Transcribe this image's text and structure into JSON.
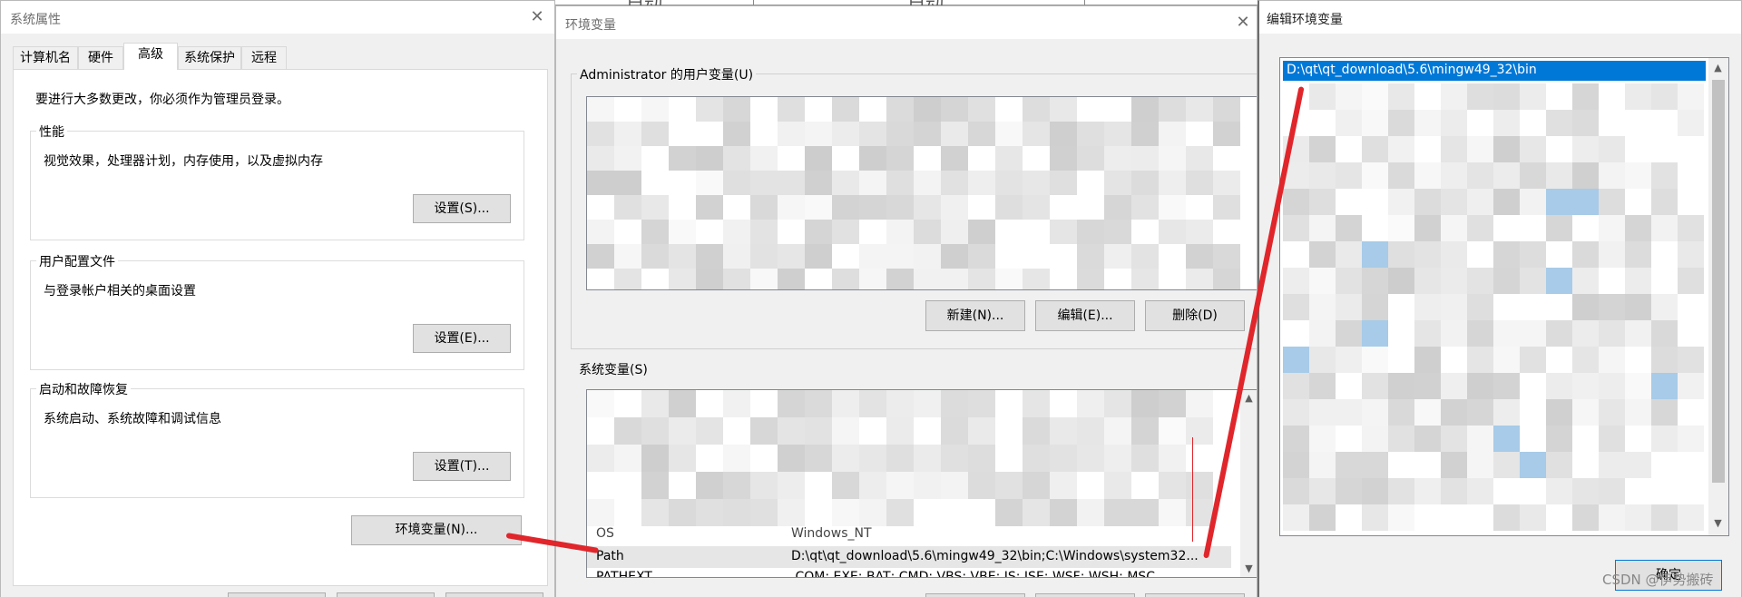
{
  "system_properties": {
    "title": "系统属性",
    "tabs": [
      {
        "label": "计算机名",
        "active": false
      },
      {
        "label": "硬件",
        "active": false
      },
      {
        "label": "高级",
        "active": true
      },
      {
        "label": "系统保护",
        "active": false
      },
      {
        "label": "远程",
        "active": false
      }
    ],
    "admin_notice": "要进行大多数更改，你必须作为管理员登录。",
    "performance": {
      "title": "性能",
      "desc": "视觉效果，处理器计划，内存使用，以及虚拟内存",
      "button": "设置(S)..."
    },
    "user_profiles": {
      "title": "用户配置文件",
      "desc": "与登录帐户相关的桌面设置",
      "button": "设置(E)..."
    },
    "startup_recovery": {
      "title": "启动和故障恢复",
      "desc": "系统启动、系统故障和调试信息",
      "button": "设置(T)..."
    },
    "env_button": "环境变量(N)..."
  },
  "env_vars": {
    "title": "环境变量",
    "user_section": "Administrator 的用户变量(U)",
    "user_buttons": {
      "new": "新建(N)...",
      "edit": "编辑(E)...",
      "delete": "删除(D)"
    },
    "system_section": "系统变量(S)",
    "system_rows": [
      {
        "name": "OS",
        "value": "Windows_NT"
      },
      {
        "name": "Path",
        "value": "D:\\qt\\qt_download\\5.6\\mingw49_32\\bin;C:\\Windows\\system32..."
      },
      {
        "name": "PATHEXT",
        "value": ".COM;.EXE;.BAT;.CMD;.VBS;.VBE;.JS;.JSE;.WSF;.WSH;.MSC"
      }
    ]
  },
  "edit_env": {
    "title": "编辑环境变量",
    "selected_entry": "D:\\qt\\qt_download\\5.6\\mingw49_32\\bin",
    "ok_button": "确定"
  },
  "background_labels": [
    "自动",
    "自动"
  ],
  "watermark": "CSDN @伊势搬砖",
  "colors": {
    "selection": "#0078d7",
    "annotation": "#e0262b",
    "dialog_bg": "#f0f0f0"
  }
}
